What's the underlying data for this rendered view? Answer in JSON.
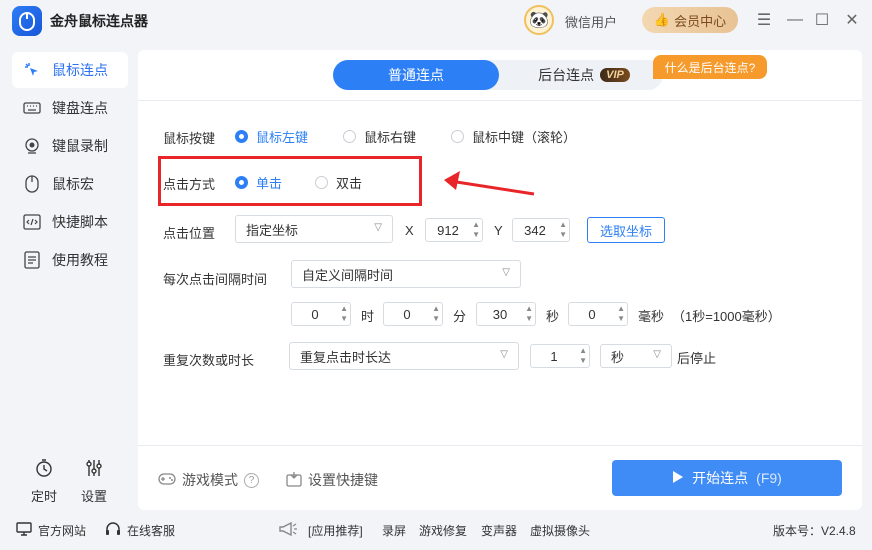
{
  "app": {
    "title": "金舟鼠标连点器",
    "user_name": "微信用户",
    "vip_center": "会员中心"
  },
  "sidebar": {
    "items": [
      {
        "label": "鼠标连点",
        "icon": "mouse-click-icon",
        "active": true
      },
      {
        "label": "键盘连点",
        "icon": "keyboard-icon",
        "active": false
      },
      {
        "label": "键鼠录制",
        "icon": "record-icon",
        "active": false
      },
      {
        "label": "鼠标宏",
        "icon": "mouse-icon",
        "active": false
      },
      {
        "label": "快捷脚本",
        "icon": "script-icon",
        "active": false
      },
      {
        "label": "使用教程",
        "icon": "tutorial-icon",
        "active": false
      }
    ],
    "timer_label": "定时",
    "settings_label": "设置"
  },
  "tabs": {
    "normal": "普通连点",
    "background": "后台连点",
    "vip_badge": "VIP",
    "tooltip": "什么是后台连点?"
  },
  "form": {
    "mouse_button": {
      "label": "鼠标按键",
      "options": [
        "鼠标左键",
        "鼠标右键",
        "鼠标中键（滚轮）"
      ],
      "selected": 0
    },
    "click_mode": {
      "label": "点击方式",
      "options": [
        "单击",
        "双击"
      ],
      "selected": 0
    },
    "click_position": {
      "label": "点击位置",
      "mode": "指定坐标",
      "x_label": "X",
      "x_value": "912",
      "y_label": "Y",
      "y_value": "342",
      "pick_button": "选取坐标"
    },
    "interval": {
      "label": "每次点击间隔时间",
      "mode": "自定义间隔时间",
      "hours": "0",
      "hours_unit": "时",
      "minutes": "0",
      "minutes_unit": "分",
      "seconds": "30",
      "seconds_unit": "秒",
      "ms": "0",
      "ms_unit": "毫秒",
      "note": "（1秒=1000毫秒）"
    },
    "repeat": {
      "label": "重复次数或时长",
      "mode": "重复点击时长达",
      "count": "1",
      "unit": "秒",
      "suffix": "后停止"
    }
  },
  "footer": {
    "game_mode": "游戏模式",
    "shortcut": "设置快捷键",
    "start_button": "开始连点",
    "start_hotkey": "(F9)"
  },
  "statusbar": {
    "website": "官方网站",
    "support": "在线客服",
    "recommend_label": "[应用推荐]",
    "apps": [
      "录屏",
      "游戏修复",
      "变声器",
      "虚拟摄像头"
    ],
    "version": "版本号：V2.4.8"
  },
  "colors": {
    "accent": "#2d7ff5",
    "highlight": "#e8262a",
    "vip_gold": "#e8c294"
  }
}
